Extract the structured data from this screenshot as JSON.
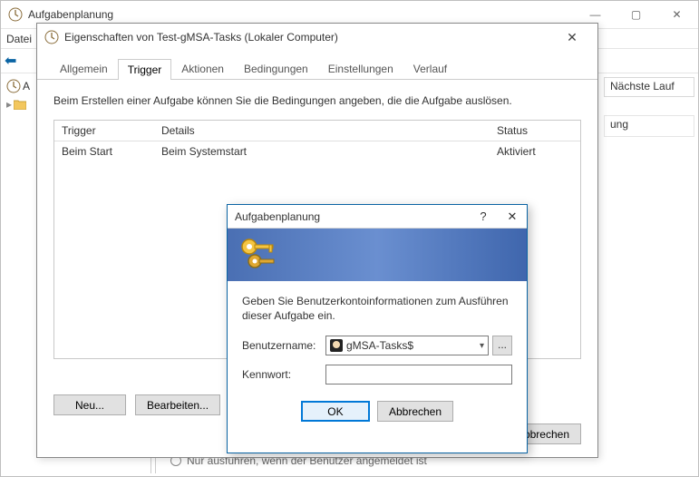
{
  "main_window": {
    "title": "Aufgabenplanung",
    "menu_file": "Datei",
    "tree_header": "A",
    "right_col_header": "Nächste Lauf",
    "right_col_cell": "ung"
  },
  "props_dialog": {
    "title": "Eigenschaften von Test-gMSA-Tasks (Lokaler Computer)",
    "tabs": [
      "Allgemein",
      "Trigger",
      "Aktionen",
      "Bedingungen",
      "Einstellungen",
      "Verlauf"
    ],
    "active_tab_index": 1,
    "hint": "Beim Erstellen einer Aufgabe können Sie die Bedingungen angeben, die die Aufgabe auslösen.",
    "columns": {
      "trigger": "Trigger",
      "details": "Details",
      "status": "Status"
    },
    "rows": [
      {
        "trigger": "Beim Start",
        "details": "Beim Systemstart",
        "status": "Aktiviert"
      }
    ],
    "buttons": {
      "new": "Neu...",
      "edit": "Bearbeiten...",
      "cancel": "Abbrechen"
    }
  },
  "cred_dialog": {
    "title": "Aufgabenplanung",
    "help_glyph": "?",
    "close_glyph": "✕",
    "message": "Geben Sie Benutzerkontoinformationen zum Ausführen dieser Aufgabe ein.",
    "username_label": "Benutzername:",
    "username_value": "gMSA-Tasks$",
    "password_label": "Kennwort:",
    "password_value": "",
    "browse_glyph": "...",
    "ok": "OK",
    "cancel": "Abbrechen"
  },
  "bottom": {
    "radio_label": "Nur ausführen, wenn der Benutzer angemeldet ist"
  }
}
